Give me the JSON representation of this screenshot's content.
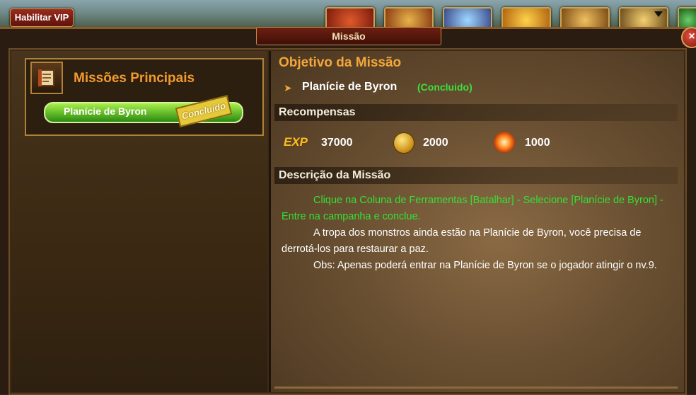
{
  "topbar": {
    "vip_label": "Habilitar VIP",
    "icons": [
      "treasure-chest-icon",
      "hero-icon",
      "crystal-icon",
      "gold-coins-icon",
      "scroll-icon",
      "ship-icon",
      "flag-icon"
    ]
  },
  "window": {
    "title": "Missão",
    "close": "×"
  },
  "left": {
    "group_title": "Missões Principais",
    "group_icon": "quest-book-icon",
    "quest": {
      "name": "Planície de Byron",
      "stamp": "Concluído"
    }
  },
  "right": {
    "objective_title": "Objetivo da Missão",
    "quest_name": "Planície de Byron",
    "quest_status": "(Concluido)",
    "rewards_title": "Recompensas",
    "rewards": {
      "exp_label": "EXP",
      "exp_value": "37000",
      "gold_value": "2000",
      "energy_value": "1000"
    },
    "description_title": "Descrição da Missão",
    "description": {
      "instruction": "Clique na Coluna de Ferramentas [Batalhar] - Selecione [Planície de Byron] - Entre na campanha e conclue.",
      "story": "A tropa dos monstros ainda estão na Planície de Byron, você precisa de derrotá-los para restaurar a paz.",
      "note": "Obs: Apenas poderá entrar na Planície de Byron se o jogador atingir o nv.9."
    }
  },
  "colors": {
    "accent_orange": "#f3a63a",
    "status_green": "#35e035",
    "quest_bar_green": "#5cc22a"
  }
}
